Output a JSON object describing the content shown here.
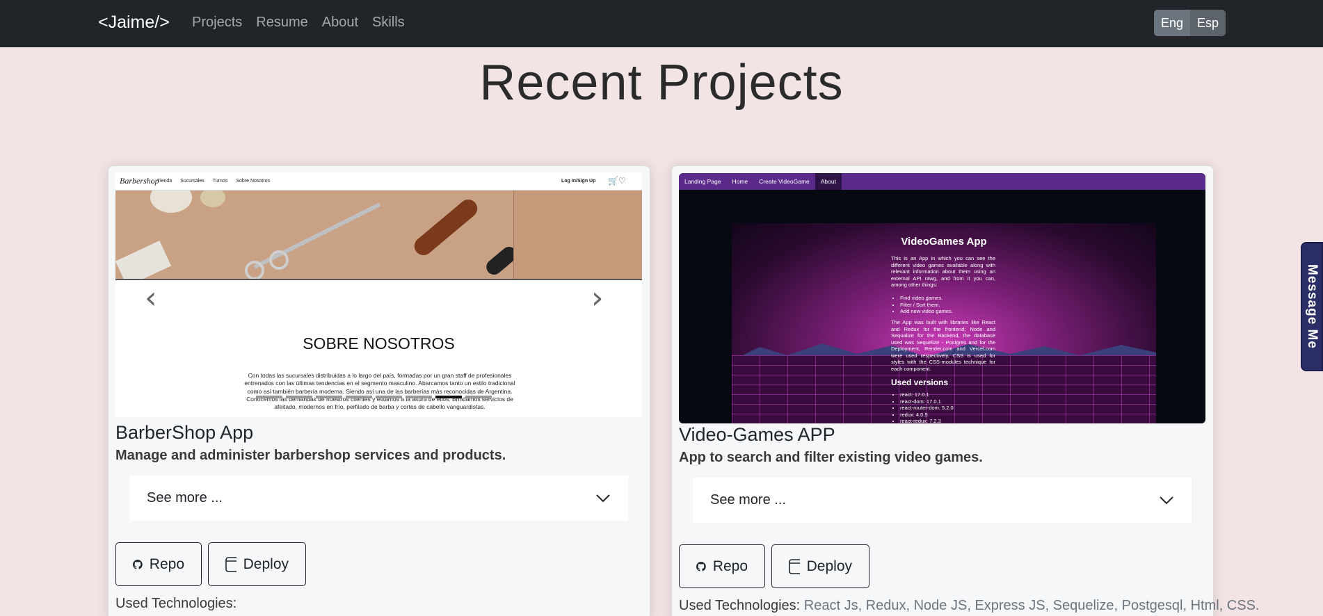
{
  "navbar": {
    "brand": "<Jaime/>",
    "links": [
      "Projects",
      "Resume",
      "About",
      "Skills"
    ],
    "languages": [
      "Eng",
      "Esp"
    ],
    "active_language": "Esp"
  },
  "page": {
    "title": "Recent Projects",
    "message_tab": "Message Me"
  },
  "projects": [
    {
      "name": "BarberShop App",
      "description": "Manage and administer barbershop services and products.",
      "see_more": "See more ...",
      "repo_label": "Repo",
      "deploy_label": "Deploy",
      "tech_label": "Used Technologies:",
      "tech_value": "",
      "screenshot": {
        "logo": "Barbershop",
        "nav": [
          "Tienda",
          "Sucursales",
          "Turnos",
          "Sobre Nosotros"
        ],
        "login": "Log In/Sign Up",
        "heading": "SOBRE NOSOTROS",
        "paragraph": "Con todas las sucursales distribuidas a lo largo del país, formadas por un gran staff de profesionales entrenados con las últimas tendencias en el segmento masculino. Abarcamos tanto un estilo tradicional como así también barbería moderna. Siendo así una de las barberías más reconocidas de Argentina. Conocemos las demandas de nuestros clientes y estamos a la altura de ellos. Brindamos servicios de afeitado, modernos en frío, perfilado de barba y cortes de cabello vanguardistas."
      }
    },
    {
      "name": "Video-Games APP",
      "description": "App to search and filter existing video games.",
      "see_more": "See more ...",
      "repo_label": "Repo",
      "deploy_label": "Deploy",
      "tech_label": "Used Technologies:",
      "tech_value": "React Js, Redux, Node JS, Express JS, Sequelize, Postgesql, Html, CSS.",
      "screenshot": {
        "nav": [
          "Landing Page",
          "Home",
          "Create VideoGame",
          "About"
        ],
        "active_nav": "About",
        "title": "VideoGames App",
        "intro": "This is an App in which you can see the different video games available along with relevant information about them using an external API rawg, and from it you can, among other things:",
        "features": [
          "Find video games.",
          "Filter / Sort them.",
          "Add new video games."
        ],
        "stack": "The App was built with libraries like React and Redux for the frontend; Node and Sequalize for the Backend, the database used was Sequelize - Postgres and for the Deployment, Render.com and Vercel.com were used respectively. CSS is used for styles with the CSS-modules technique for each component.",
        "versions_title": "Used versions",
        "versions": [
          "react: 17.0.1",
          "react-dom: 17.0.1",
          "react-router-dom: 5.2.0",
          "redux: 4.0.5",
          "react-redux: 7.2.3"
        ]
      }
    }
  ],
  "colors": {
    "navbar": "#212529",
    "background": "#f2e3e4",
    "message_tab": "#2b2d66"
  }
}
